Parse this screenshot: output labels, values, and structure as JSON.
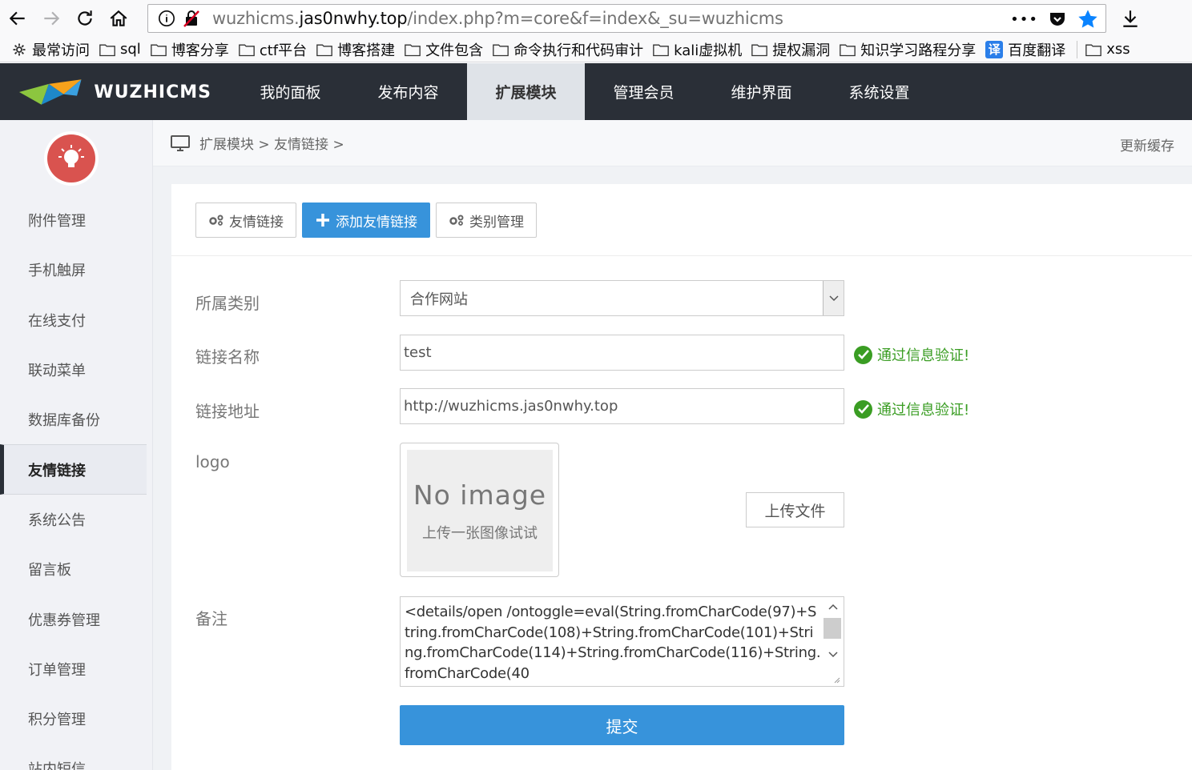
{
  "browser": {
    "url_prefix": "wuzhicms.",
    "url_host": "jas0nwhy.top",
    "url_path": "/index.php?m=core&f=index&_su=wuzhicms",
    "more_actions": "•••"
  },
  "bookmarks": [
    {
      "label": "最常访问",
      "icon": "gear-icon"
    },
    {
      "label": "sql",
      "icon": "folder-icon"
    },
    {
      "label": "博客分享",
      "icon": "folder-icon"
    },
    {
      "label": "ctf平台",
      "icon": "folder-icon"
    },
    {
      "label": "博客搭建",
      "icon": "folder-icon"
    },
    {
      "label": "文件包含",
      "icon": "folder-icon"
    },
    {
      "label": "命令执行和代码审计",
      "icon": "folder-icon"
    },
    {
      "label": "kali虚拟机",
      "icon": "folder-icon"
    },
    {
      "label": "提权漏洞",
      "icon": "folder-icon"
    },
    {
      "label": "知识学习路程分享",
      "icon": "folder-icon"
    },
    {
      "label": "百度翻译",
      "icon": "translate-icon",
      "badge": "译"
    },
    {
      "label": "xss",
      "icon": "folder-icon"
    }
  ],
  "app": {
    "logo_text": "WUZHICMS",
    "topnav": [
      "我的面板",
      "发布内容",
      "扩展模块",
      "管理会员",
      "维护界面",
      "系统设置"
    ],
    "topnav_active": "扩展模块",
    "accent": "#3793db",
    "header_bg": "#2a2f37"
  },
  "sidebar": {
    "items": [
      "附件管理",
      "手机触屏",
      "在线支付",
      "联动菜单",
      "数据库备份",
      "友情链接",
      "系统公告",
      "留言板",
      "优惠券管理",
      "订单管理",
      "积分管理",
      "站内短信"
    ],
    "active": "友情链接"
  },
  "breadcrumb": {
    "text": "扩展模块 > 友情链接 >",
    "refresh": "更新缓存"
  },
  "tabs": [
    {
      "label": "友情链接",
      "icon": "cogs-icon"
    },
    {
      "label": "添加友情链接",
      "icon": "plus-icon"
    },
    {
      "label": "类别管理",
      "icon": "cogs-icon"
    }
  ],
  "form": {
    "category_label": "所属类别",
    "category_value": "合作网站",
    "name_label": "链接名称",
    "name_value": "test",
    "url_label": "链接地址",
    "url_value": "http://wuzhicms.jas0nwhy.top",
    "validation_msg": "通过信息验证!",
    "logo_label": "logo",
    "noimage_title": "No image",
    "noimage_hint": "上传一张图像试试",
    "upload_label": "上传文件",
    "remark_label": "备注",
    "remark_value": "<details/open /ontoggle=eval(String.fromCharCode(97)+String.fromCharCode(108)+String.fromCharCode(101)+String.fromCharCode(114)+String.fromCharCode(116)+String.fromCharCode(40",
    "submit_label": "提交",
    "valid_color": "#3a9d23"
  }
}
